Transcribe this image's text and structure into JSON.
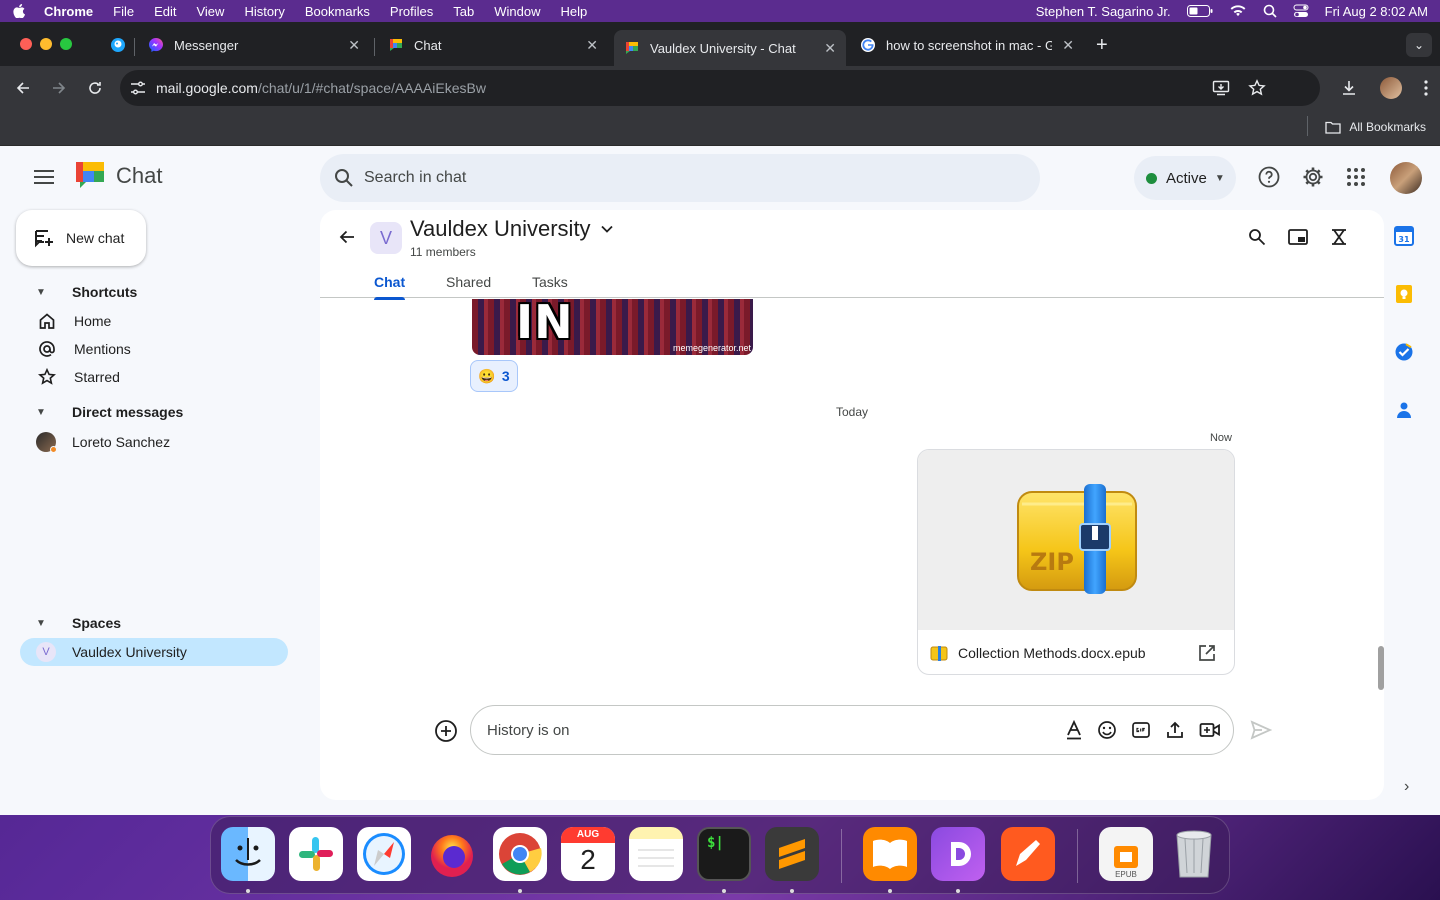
{
  "menubar": {
    "app": "Chrome",
    "items": [
      "File",
      "Edit",
      "View",
      "History",
      "Bookmarks",
      "Profiles",
      "Tab",
      "Window",
      "Help"
    ],
    "user": "Stephen T. Sagarino Jr.",
    "datetime": "Fri Aug 2  8:02 AM"
  },
  "browser": {
    "tabs": [
      {
        "title": "Messenger"
      },
      {
        "title": "Chat"
      },
      {
        "title": "Vauldex University - Chat"
      },
      {
        "title": "how to screenshot in mac - G"
      }
    ],
    "url_host": "mail.google.com",
    "url_path": "/chat/u/1/#chat/space/AAAAiEkesBw",
    "all_bookmarks": "All Bookmarks"
  },
  "app": {
    "name": "Chat",
    "search_placeholder": "Search in chat",
    "status": "Active",
    "status_color": "#1e8e3e",
    "new_chat": "New chat"
  },
  "sidebar": {
    "shortcuts_label": "Shortcuts",
    "shortcuts": [
      {
        "label": "Home",
        "icon": "home-icon"
      },
      {
        "label": "Mentions",
        "icon": "at-icon"
      },
      {
        "label": "Starred",
        "icon": "star-icon"
      }
    ],
    "dm_label": "Direct messages",
    "dms": [
      {
        "label": "Loreto Sanchez"
      }
    ],
    "spaces_label": "Spaces",
    "spaces": [
      {
        "initial": "V",
        "label": "Vauldex University"
      }
    ]
  },
  "conversation": {
    "initial": "V",
    "title": "Vauldex University",
    "members": "11 members",
    "tabs": [
      "Chat",
      "Shared",
      "Tasks"
    ],
    "meme_text": "IN SCALA",
    "meme_watermark": "memegenerator.net",
    "reaction_emoji": "😀",
    "reaction_count": "3",
    "day_divider": "Today",
    "message_time": "Now",
    "attachment_name": "Collection Methods.docx.epub",
    "attachment_badge": "ZIP",
    "composer_placeholder": "History is on"
  },
  "dock": {
    "calendar_month": "AUG",
    "calendar_day": "2",
    "terminal_prompt": "$|",
    "epub_label": "EPUB"
  }
}
